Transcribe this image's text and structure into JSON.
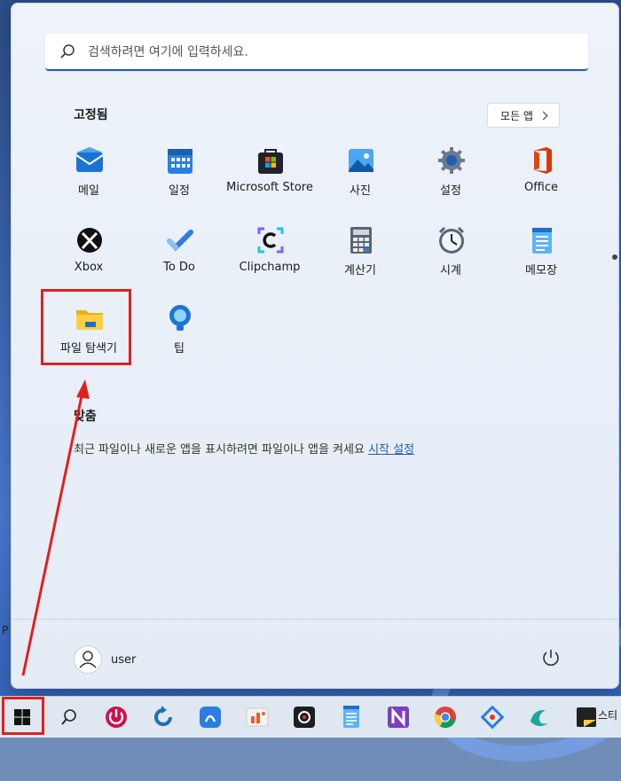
{
  "search": {
    "placeholder": "검색하려면 여기에 입력하세요."
  },
  "pinned": {
    "title": "고정됨",
    "all_apps_label": "모든 앱",
    "apps": [
      {
        "label": "메일",
        "icon": "mail-icon"
      },
      {
        "label": "일정",
        "icon": "calendar-icon"
      },
      {
        "label": "Microsoft Store",
        "icon": "store-icon"
      },
      {
        "label": "사진",
        "icon": "photos-icon"
      },
      {
        "label": "설정",
        "icon": "gear-icon"
      },
      {
        "label": "Office",
        "icon": "office-icon"
      },
      {
        "label": "Xbox",
        "icon": "xbox-icon"
      },
      {
        "label": "To Do",
        "icon": "todo-icon"
      },
      {
        "label": "Clipchamp",
        "icon": "clipchamp-icon"
      },
      {
        "label": "계산기",
        "icon": "calculator-icon"
      },
      {
        "label": "시계",
        "icon": "clock-icon"
      },
      {
        "label": "메모장",
        "icon": "notepad-icon"
      },
      {
        "label": "파일 탐색기",
        "icon": "folder-icon"
      },
      {
        "label": "팁",
        "icon": "tips-icon"
      }
    ]
  },
  "recommended": {
    "title": "맞춤",
    "text": "최근 파일이나 새로운 앱을 표시하려면 파일이나 앱을 켜세요",
    "link": "시작 설정"
  },
  "user": {
    "name": "user"
  },
  "desktop": {
    "edge_text": "P"
  },
  "taskbar": {
    "last_label": "스티",
    "items": [
      "windows-logo-icon",
      "search-icon",
      "power-app-icon",
      "refresh-app-icon",
      "app-icon",
      "office-app-icon",
      "camera-app-icon",
      "notepad-app-icon",
      "onenote-icon",
      "chrome-icon",
      "network-app-icon",
      "browser-app-icon",
      "sticky-notes-icon"
    ]
  },
  "colors": {
    "accent": "#1a5fb4",
    "highlight": "#e02020"
  }
}
